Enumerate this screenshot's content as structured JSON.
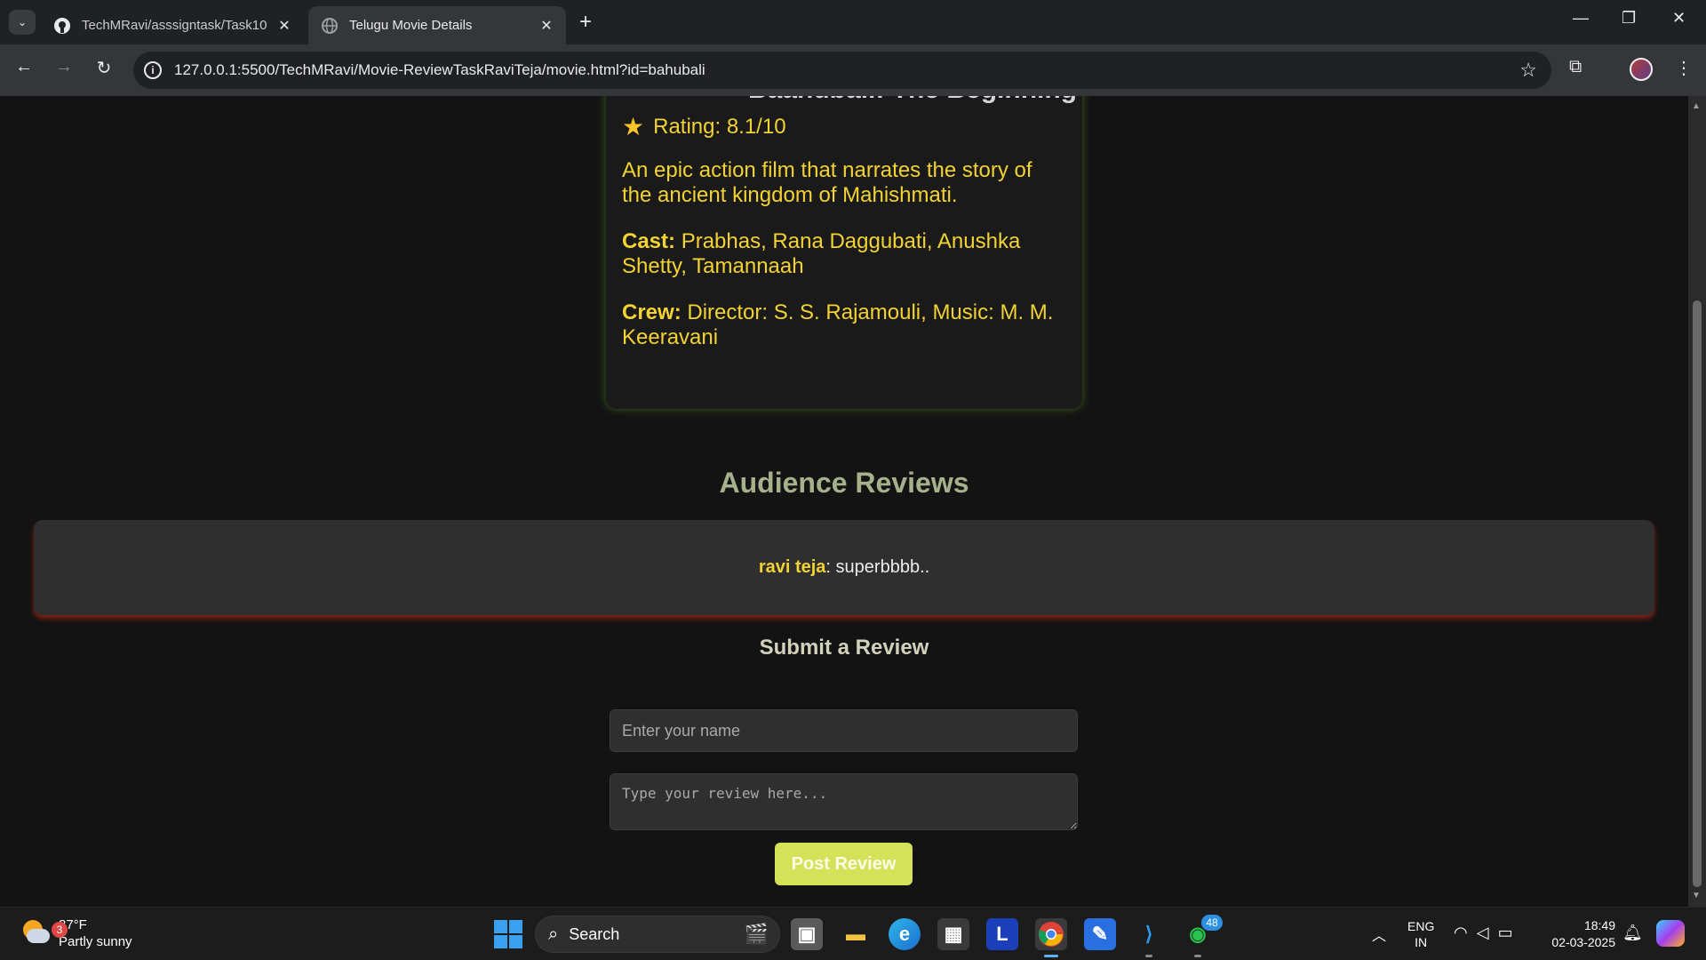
{
  "browser": {
    "tabs": [
      {
        "title": "TechMRavi/asssigntask/Task10",
        "icon": "github-icon"
      },
      {
        "title": "Telugu Movie Details",
        "icon": "globe-icon"
      }
    ],
    "url": "127.0.0.1:5500/TechMRavi/Movie-ReviewTaskRaviTeja/movie.html?id=bahubali"
  },
  "movie": {
    "title_clipped": "Baahubali: The Beginning",
    "rating": "Rating: 8.1/10",
    "description": "An epic action film that narrates the story of the ancient kingdom of Mahishmati.",
    "cast_label": "Cast:",
    "cast": "Prabhas, Rana Daggubati, Anushka Shetty, Tamannaah",
    "crew_label": "Crew:",
    "crew": "Director: S. S. Rajamouli, Music: M. M. Keeravani"
  },
  "reviews": {
    "heading": "Audience Reviews",
    "items": [
      {
        "name": "ravi teja",
        "separator": ": ",
        "text": "superbbbb.."
      }
    ]
  },
  "form": {
    "heading": "Submit a Review",
    "name_placeholder": "Enter your name",
    "review_placeholder": "Type your review here...",
    "button_label": "Post Review"
  },
  "taskbar": {
    "weather_temp": "87°F",
    "weather_desc": "Partly sunny",
    "weather_badge": "3",
    "search_label": "Search",
    "whatsapp_badge": "48",
    "lang_line1": "ENG",
    "lang_line2": "IN",
    "time": "18:49",
    "date": "02-03-2025"
  },
  "colors": {
    "accent_yellow": "#f3d234",
    "button": "#d4e25a",
    "heading_olive": "#a6b08a"
  }
}
